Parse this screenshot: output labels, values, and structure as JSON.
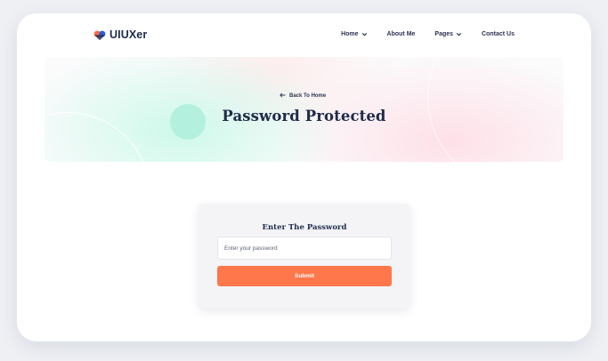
{
  "header": {
    "logo_text": "UIUXer",
    "nav": [
      {
        "label": "Home",
        "has_dropdown": true
      },
      {
        "label": "About Me",
        "has_dropdown": false
      },
      {
        "label": "Pages",
        "has_dropdown": true
      },
      {
        "label": "Contact Us",
        "has_dropdown": false
      }
    ]
  },
  "hero": {
    "back_link": "Back To Home",
    "title": "Password Protected"
  },
  "form": {
    "title": "Enter The Password",
    "input_placeholder": "Enter your password",
    "submit_label": "Submit"
  },
  "colors": {
    "accent": "#ff774b",
    "heading": "#1f2a4b",
    "hero_circle": "#b3f0de"
  }
}
